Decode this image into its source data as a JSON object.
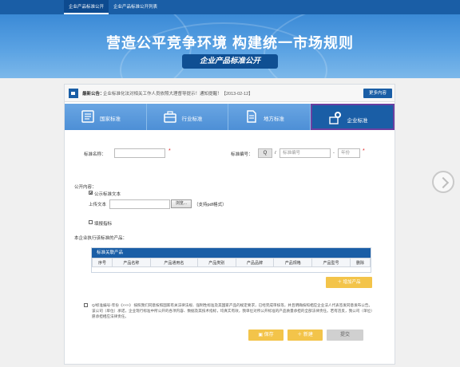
{
  "nav": {
    "items": [
      "企业产品标准公开",
      "企业产品标准公开列表"
    ]
  },
  "banner": {
    "title": "营造公平竞争环境 构建统一市场规则",
    "subtitle": "企业产品标准公开"
  },
  "notice": {
    "label": "最新公告：",
    "text": "企业标准化法对相关工作人员依照大理督导提示！通知提醒！【2013-02-12】",
    "more": "更多内容"
  },
  "tabs": [
    "国家标准",
    "行业标准",
    "地方标准",
    "企业标准"
  ],
  "form": {
    "std_name_label": "标准名称：",
    "std_no_label": "标准编号：",
    "q_prefix": "Q",
    "std_no_placeholder": "标准编号",
    "year_placeholder": "年份",
    "public_content_label": "公开内容：",
    "public_text_option": "公示标准文本",
    "upload_label": "上传文本",
    "browse_label": "浏览...",
    "upload_hint": "（支持pdf格式）",
    "indicator_option": "填报指标",
    "product_section_label": "本企业执行该标准的产品：",
    "sub_head": "标准关联产品",
    "columns": [
      "序号",
      "产品名称",
      "产品通用名",
      "产品类别",
      "产品品牌",
      "产品规格",
      "产品型号",
      "删除"
    ],
    "add_product": "增加产品",
    "declaration": "Q/标准编号-年份《×××》 按照我们同意按照国家有关法律法规、强制性标准及其国家产品的规定要求，已经完成审核等，并且明确按照相应企业法人代表签发同意发布公告。该公司（单位）承诺，企业现行标准中所公开的各项内容、数据及其技术指标，均真实有效，我单位对所公开标准的产品质量承担的全部法律责任。若有违反，我公司（单位）愿承担相应法律责任。",
    "save": "保存",
    "submit_yellow": "新建",
    "submit": "提交"
  }
}
